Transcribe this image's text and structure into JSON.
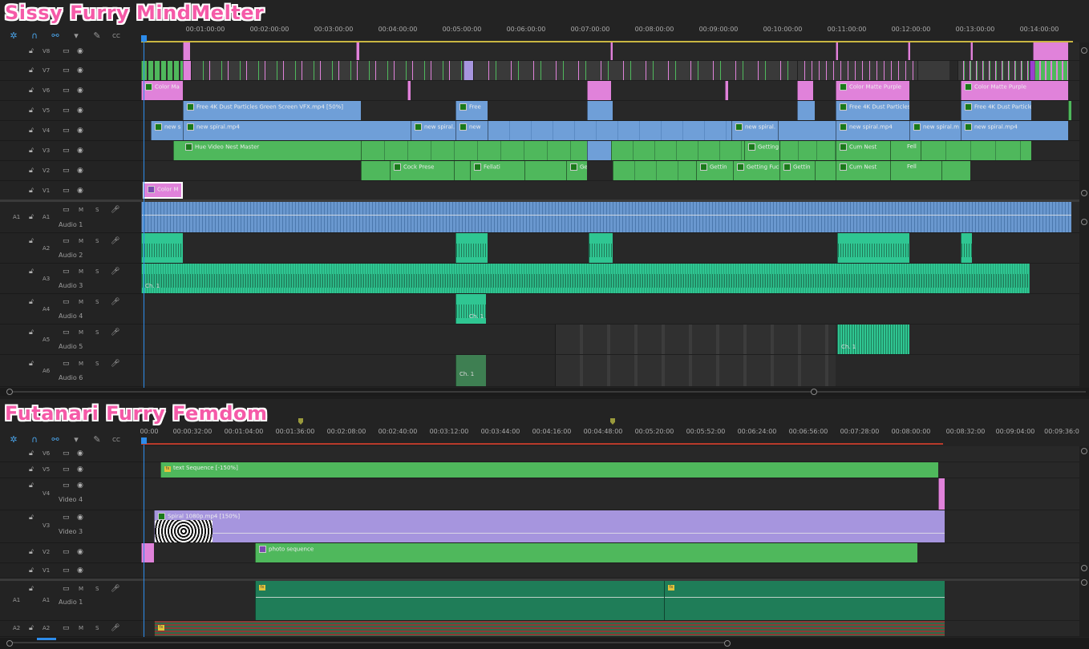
{
  "panels": [
    {
      "title": "Sissy Furry MindMelter",
      "timecodes": [
        "00:01:00:00",
        "00:02:00:00",
        "00:03:00:00",
        "00:04:00:00",
        "00:05:00:00",
        "00:06:00:00",
        "00:07:00:00",
        "00:08:00:00",
        "00:09:00:00",
        "00:10:00:00",
        "00:11:00:00",
        "00:12:00:00",
        "00:13:00:00",
        "00:14:00:00"
      ],
      "video_tracks": [
        "V8",
        "V7",
        "V6",
        "V5",
        "V4",
        "V3",
        "V2",
        "V1"
      ],
      "audio_tracks": [
        {
          "id": "A1",
          "src": "A1",
          "name": "Audio 1"
        },
        {
          "id": "A2",
          "src": "",
          "name": "Audio 2"
        },
        {
          "id": "A3",
          "src": "",
          "name": "Audio 3"
        },
        {
          "id": "A4",
          "src": "",
          "name": "Audio 4"
        },
        {
          "id": "A5",
          "src": "",
          "name": "Audio 5"
        },
        {
          "id": "A6",
          "src": "",
          "name": "Audio 6"
        }
      ],
      "clip_labels": {
        "v6_a": "Color Ma",
        "v6_b": "Color Matte Purple",
        "v6_c": "Color Matte Purple",
        "v5_a": "Free 4K Dust Particles Green Screen VFX.mp4 [50%]",
        "v5_b": "Free",
        "v5_c": "Free 4K Dust Particles",
        "v5_d": "Free 4K Dust Particle",
        "v4_a": "new s",
        "v4_b": "new spiral.mp4",
        "v4_c": "new spiral.",
        "v4_d": "new",
        "v4_e": "new spiral.",
        "v4_f": "new spiral.mp4",
        "v4_g": "new spiral.m",
        "v4_h": "new spiral.mp4",
        "v3_a": "Hue Video Nest Master",
        "v3_b": "Getting Fu",
        "v3_c": "Cum Nest",
        "v3_d": "Fell",
        "v2_a": "Cock Prese",
        "v2_b": "Fellati",
        "v2_c": "Gettin",
        "v2_d": "Gettin",
        "v2_e": "Getting Fuck",
        "v2_f": "Gettin",
        "v2_g": "Cum Nest",
        "v2_h": "Fell",
        "v1_a": "Color M",
        "ch1": "Ch. 1"
      }
    },
    {
      "title": "Futanari Furry Femdom",
      "timecodes": [
        "00:00",
        "00:00:32:00",
        "00:01:04:00",
        "00:01:36:00",
        "00:02:08:00",
        "00:02:40:00",
        "00:03:12:00",
        "00:03:44:00",
        "00:04:16:00",
        "00:04:48:00",
        "00:05:20:00",
        "00:05:52:00",
        "00:06:24:00",
        "00:06:56:00",
        "00:07:28:00",
        "00:08:00:00",
        "00:08:32:00",
        "00:09:04:00",
        "00:09:36:0"
      ],
      "video_tracks": [
        {
          "id": "V6",
          "name": ""
        },
        {
          "id": "V5",
          "name": ""
        },
        {
          "id": "V4",
          "name": "Video 4"
        },
        {
          "id": "V3",
          "name": "Video 3"
        },
        {
          "id": "V2",
          "name": ""
        },
        {
          "id": "V1",
          "name": ""
        }
      ],
      "audio_tracks": [
        {
          "id": "A1",
          "src": "A1",
          "name": "Audio 1"
        },
        {
          "id": "A2",
          "src": "A2",
          "name": ""
        }
      ],
      "clip_labels": {
        "v5": "text Sequence [-150%]",
        "v3": "Spiral 1080p.mp4 [150%]",
        "v2": "photo sequence"
      }
    }
  ],
  "track_controls": {
    "mute": "M",
    "solo": "S"
  },
  "icons": [
    "ripple-snap-icon",
    "magnet-icon",
    "linked-selection-icon",
    "marker-icon",
    "wrench-icon",
    "captions-icon",
    "lock-icon",
    "film-icon",
    "eye-icon",
    "mic-icon"
  ]
}
